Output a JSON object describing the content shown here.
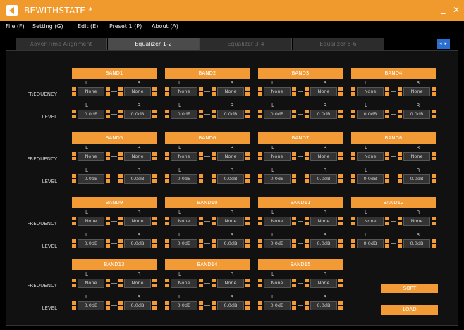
{
  "window": {
    "title": "BEWITHSTATE *",
    "minimize": "_",
    "close": "✕",
    "accent": "#f09a2e"
  },
  "menu": [
    "File (F)",
    "Setting (G)",
    "Edit (E)",
    "Preset 1 (P)",
    "About (A)"
  ],
  "tabs": [
    {
      "label": "Xover-Time Alignment",
      "active": false
    },
    {
      "label": "Equalizer 1-2",
      "active": true
    },
    {
      "label": "Equalizer 3-4",
      "active": false
    },
    {
      "label": "Equalizer 5-6",
      "active": false
    }
  ],
  "tab_scroll": "◂ ▸",
  "labels": {
    "frequency": "FREQUENCY",
    "level": "LEVEL",
    "left": "L",
    "right": "R"
  },
  "bands": [
    {
      "name": "BAND1",
      "freq_l": "None",
      "freq_r": "None",
      "level_l": "0.0dB",
      "level_r": "0.0dB"
    },
    {
      "name": "BAND2",
      "freq_l": "None",
      "freq_r": "None",
      "level_l": "0.0dB",
      "level_r": "0.0dB"
    },
    {
      "name": "BAND3",
      "freq_l": "None",
      "freq_r": "None",
      "level_l": "0.0dB",
      "level_r": "0.0dB"
    },
    {
      "name": "BAND4",
      "freq_l": "None",
      "freq_r": "None",
      "level_l": "0.0dB",
      "level_r": "0.0dB"
    },
    {
      "name": "BAND5",
      "freq_l": "None",
      "freq_r": "None",
      "level_l": "0.0dB",
      "level_r": "0.0dB"
    },
    {
      "name": "BAND6",
      "freq_l": "None",
      "freq_r": "None",
      "level_l": "0.0dB",
      "level_r": "0.0dB"
    },
    {
      "name": "BAND7",
      "freq_l": "None",
      "freq_r": "None",
      "level_l": "0.0dB",
      "level_r": "0.0dB"
    },
    {
      "name": "BAND8",
      "freq_l": "None",
      "freq_r": "None",
      "level_l": "0.0dB",
      "level_r": "0.0dB"
    },
    {
      "name": "BAND9",
      "freq_l": "None",
      "freq_r": "None",
      "level_l": "0.0dB",
      "level_r": "0.0dB"
    },
    {
      "name": "BAND10",
      "freq_l": "None",
      "freq_r": "None",
      "level_l": "0.0dB",
      "level_r": "0.0dB"
    },
    {
      "name": "BAND11",
      "freq_l": "None",
      "freq_r": "None",
      "level_l": "0.0dB",
      "level_r": "0.0dB"
    },
    {
      "name": "BAND12",
      "freq_l": "None",
      "freq_r": "None",
      "level_l": "0.0dB",
      "level_r": "0.0dB"
    },
    {
      "name": "BAND13",
      "freq_l": "None",
      "freq_r": "None",
      "level_l": "0.0dB",
      "level_r": "0.0dB"
    },
    {
      "name": "BAND14",
      "freq_l": "None",
      "freq_r": "None",
      "level_l": "0.0dB",
      "level_r": "0.0dB"
    },
    {
      "name": "BAND15",
      "freq_l": "None",
      "freq_r": "None",
      "level_l": "0.0dB",
      "level_r": "0.0dB"
    }
  ],
  "buttons": {
    "sort": "SORT",
    "load": "LOAD"
  }
}
